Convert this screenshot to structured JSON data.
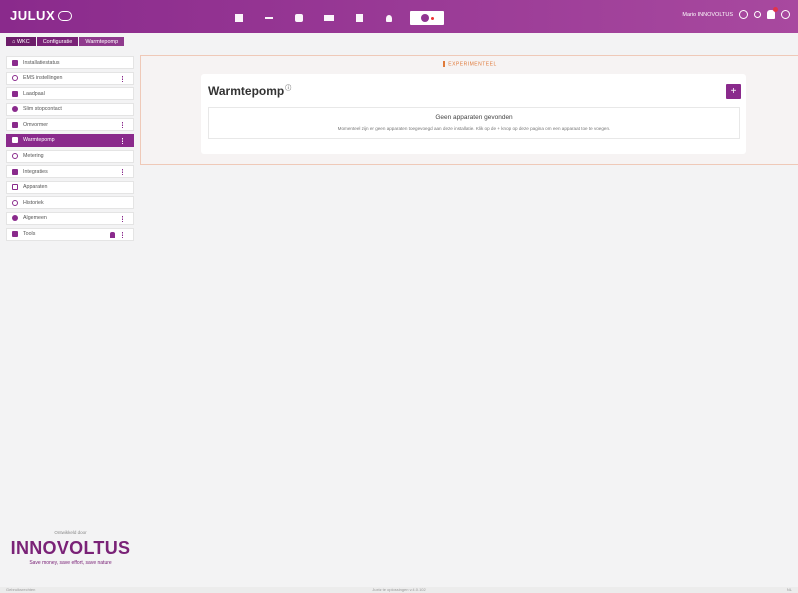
{
  "app": {
    "logo": "JULUX"
  },
  "breadcrumb": [
    "WKC",
    "Configuratie",
    "Warmtepomp"
  ],
  "nav": {
    "icons": [
      "dashboard-icon",
      "chart-icon",
      "chat-icon",
      "meter-icon",
      "document-icon",
      "bulb-icon",
      "settings-icon"
    ],
    "active": "settings-icon"
  },
  "user": {
    "name": "Mario INNOVOLTUS"
  },
  "sidebar": {
    "items": [
      {
        "label": "Installatiestatus",
        "icon": "status-icon",
        "kebab": false
      },
      {
        "label": "EMS instellingen",
        "icon": "ems-icon",
        "kebab": true
      },
      {
        "label": "Laadpaal",
        "icon": "charger-icon",
        "kebab": false
      },
      {
        "label": "Slim stopcontact",
        "icon": "plug-icon",
        "kebab": false
      },
      {
        "label": "Omvormer",
        "icon": "inverter-icon",
        "kebab": true
      },
      {
        "label": "Warmtepomp",
        "icon": "heatpump-icon",
        "kebab": true,
        "active": true
      },
      {
        "label": "Metering",
        "icon": "metering-icon",
        "kebab": false
      },
      {
        "label": "Integraties",
        "icon": "puzzle-icon",
        "kebab": true
      },
      {
        "label": "Apparaten",
        "icon": "devices-icon",
        "kebab": false
      },
      {
        "label": "Historiek",
        "icon": "history-icon",
        "kebab": false
      },
      {
        "label": "Algemeen",
        "icon": "gear-icon",
        "kebab": true
      },
      {
        "label": "Tools",
        "icon": "tools-icon",
        "kebab": true,
        "person": true
      }
    ]
  },
  "brand": {
    "small": "Ontwikkeld door",
    "name": "INNOVOLTUS",
    "tagline": "Save money, save effort, save nature"
  },
  "main": {
    "experimental_label": "EXPERIMENTEEL",
    "title": "Warmtepomp",
    "add_label": "+",
    "empty_title": "Geen apparaten gevonden",
    "empty_desc": "Momenteel zijn er geen apparaten toegevoegd aan deze installatie. Klik op de + knop op deze pagina om een apparaat toe te voegen."
  },
  "footer": {
    "left": "Gebruiksrechten",
    "center": "Juxtz te oplossingen v.4.0.102",
    "right": "NL"
  },
  "colors": {
    "primary": "#8a2a8c",
    "accent": "#e07a3a"
  }
}
